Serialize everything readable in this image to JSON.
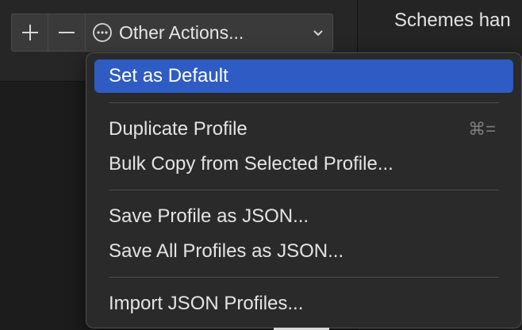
{
  "toolbar": {
    "add_icon": "plus-icon",
    "remove_icon": "minus-icon",
    "actions_icon": "ellipsis-circle-icon",
    "actions_label": "Other Actions...",
    "dropdown_icon": "chevron-down-icon"
  },
  "right_panel": {
    "heading": "Schemes han"
  },
  "menu": {
    "items": [
      {
        "label": "Set as Default",
        "highlighted": true
      },
      {
        "label": "Duplicate Profile",
        "shortcut": "⌘="
      },
      {
        "label": "Bulk Copy from Selected Profile..."
      },
      {
        "label": "Save Profile as JSON..."
      },
      {
        "label": "Save All Profiles as JSON..."
      },
      {
        "label": "Import JSON Profiles..."
      }
    ]
  },
  "colors": {
    "highlight": "#2f5cc4",
    "menu_bg": "#2a2a2a",
    "text": "#e4e4e4"
  }
}
